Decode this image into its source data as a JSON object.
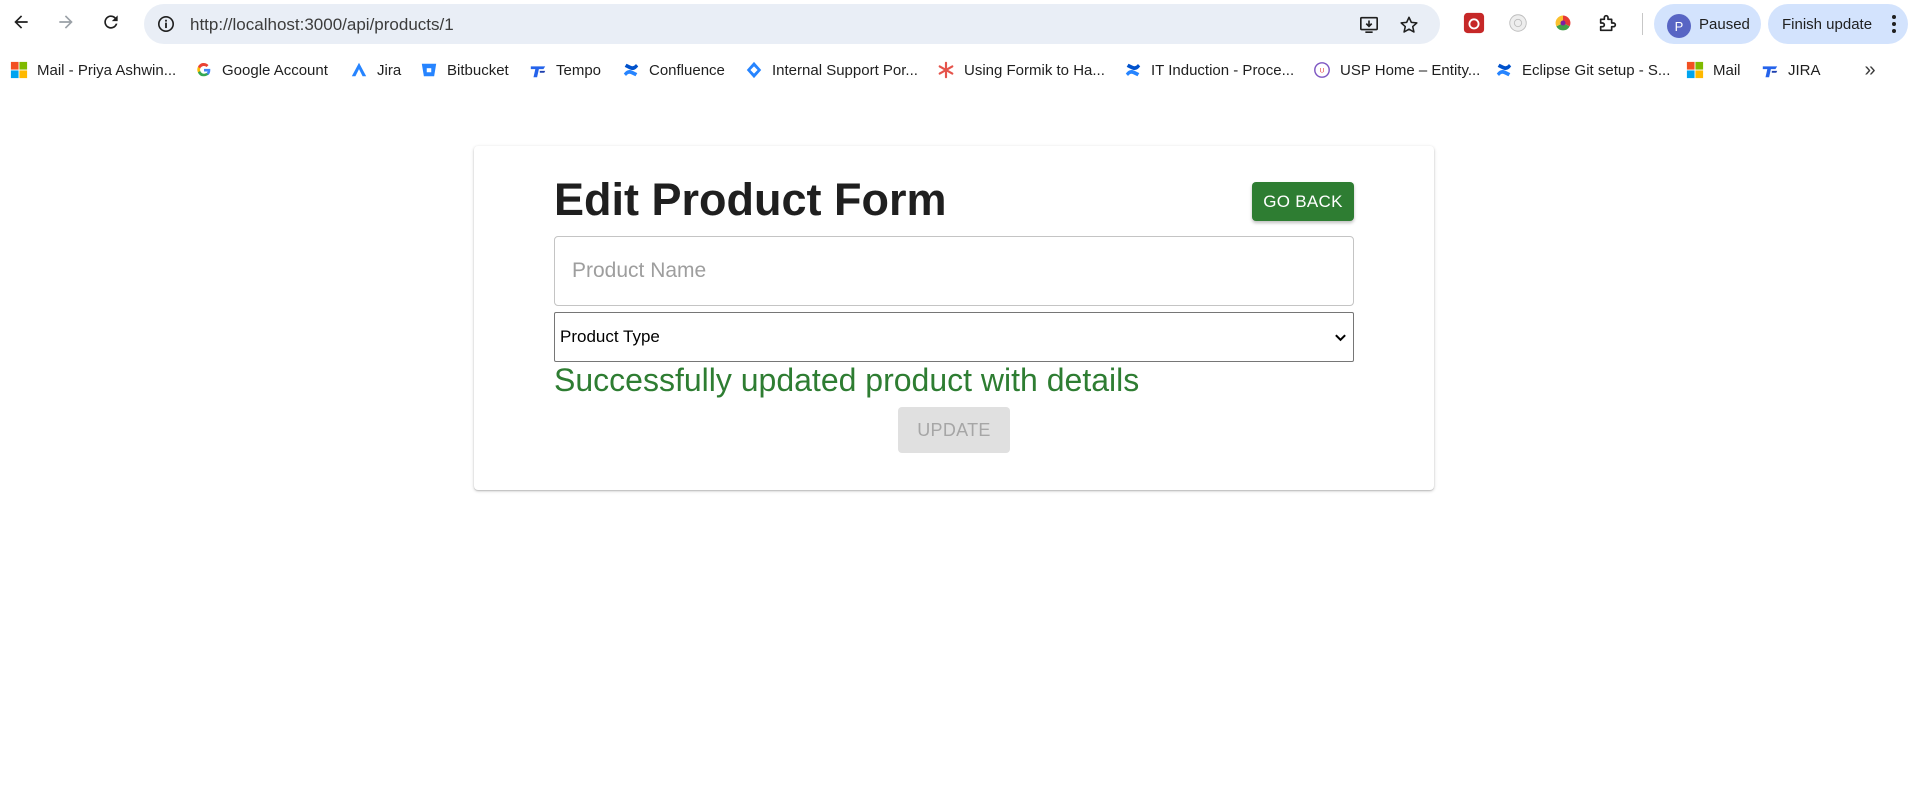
{
  "browser": {
    "url": "http://localhost:3000/api/products/1",
    "profile": {
      "initial": "P",
      "status": "Paused"
    },
    "update_button": "Finish update",
    "bookmarks": [
      {
        "label": "Mail - Priya Ashwin...",
        "icon": "microsoft-icon"
      },
      {
        "label": "Google Account",
        "icon": "google-icon"
      },
      {
        "label": "Jira",
        "icon": "jira-icon"
      },
      {
        "label": "Bitbucket",
        "icon": "bitbucket-icon"
      },
      {
        "label": "Tempo",
        "icon": "tempo-icon"
      },
      {
        "label": "Confluence",
        "icon": "confluence-icon"
      },
      {
        "label": "Internal Support Por...",
        "icon": "jira-service-icon"
      },
      {
        "label": "Using Formik to Ha...",
        "icon": "asterisk-icon"
      },
      {
        "label": "IT Induction - Proce...",
        "icon": "confluence-icon"
      },
      {
        "label": "USP Home – Entity...",
        "icon": "usp-icon"
      },
      {
        "label": "Eclipse Git setup - S...",
        "icon": "confluence-icon"
      },
      {
        "label": "Mail",
        "icon": "microsoft-icon"
      },
      {
        "label": "JIRA",
        "icon": "tempo-icon"
      }
    ]
  },
  "form": {
    "title": "Edit Product Form",
    "go_back_label": "GO BACK",
    "name_placeholder": "Product Name",
    "type_select_value": "Product Type",
    "success_message": "Successfully updated product with details",
    "update_label": "UPDATE"
  },
  "colors": {
    "success_green": "#2e7d32",
    "disabled_gray": "#e0e0e0",
    "omnibox_bg": "#e9eef6",
    "pill_bg": "#d3e3fd"
  }
}
